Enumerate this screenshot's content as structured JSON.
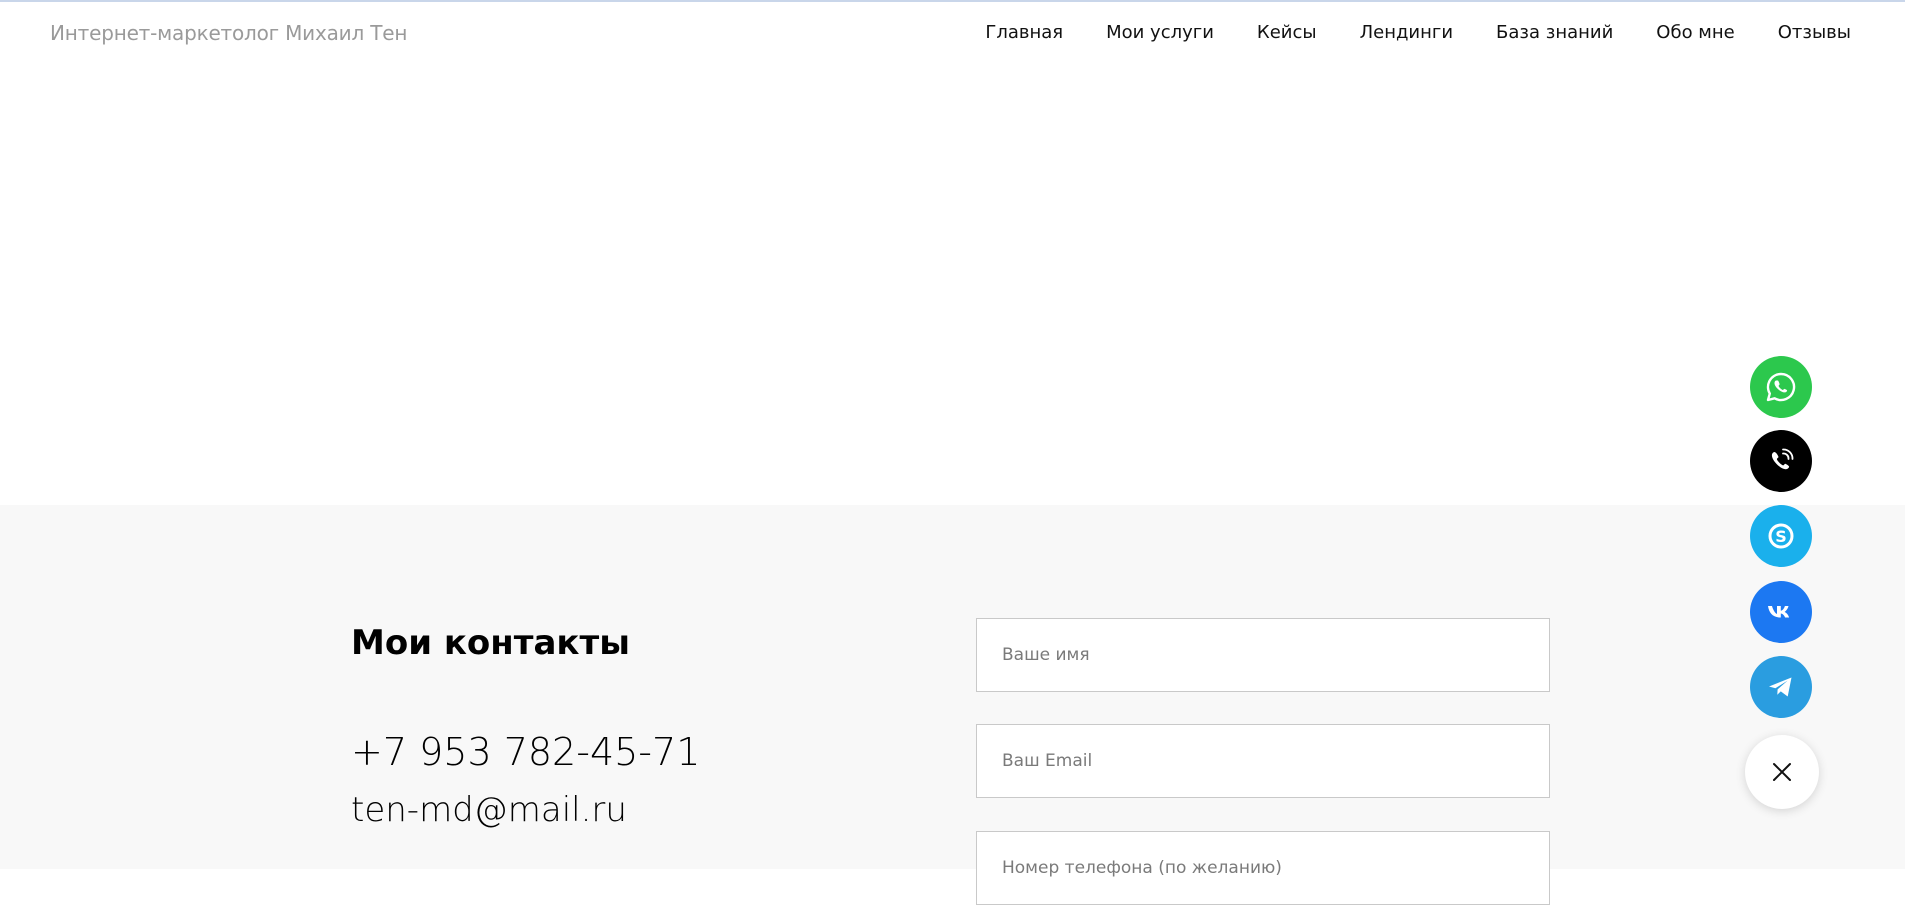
{
  "header": {
    "brand": "Интернет-маркетолог Михаил Тен",
    "nav": [
      {
        "label": "Главная"
      },
      {
        "label": "Мои услуги"
      },
      {
        "label": "Кейсы"
      },
      {
        "label": "Лендинги"
      },
      {
        "label": "База знаний"
      },
      {
        "label": "Обо мне"
      },
      {
        "label": "Отзывы"
      }
    ]
  },
  "contacts": {
    "title": "Мои контакты",
    "phone": "+7 953 782-45-71",
    "email": "ten-md@mail.ru"
  },
  "form": {
    "name_placeholder": "Ваше имя",
    "email_placeholder": "Ваш Email",
    "phone_placeholder": "Номер телефона (по желанию)"
  },
  "widgets": [
    {
      "icon": "whatsapp-icon",
      "color": "#2cc84d"
    },
    {
      "icon": "phone-icon",
      "color": "#000000"
    },
    {
      "icon": "skype-icon",
      "color": "#1ab0ec"
    },
    {
      "icon": "vk-icon",
      "color": "#1c78f2"
    },
    {
      "icon": "telegram-icon",
      "color": "#2a9de0"
    },
    {
      "icon": "close-icon",
      "color": "#ffffff"
    }
  ]
}
